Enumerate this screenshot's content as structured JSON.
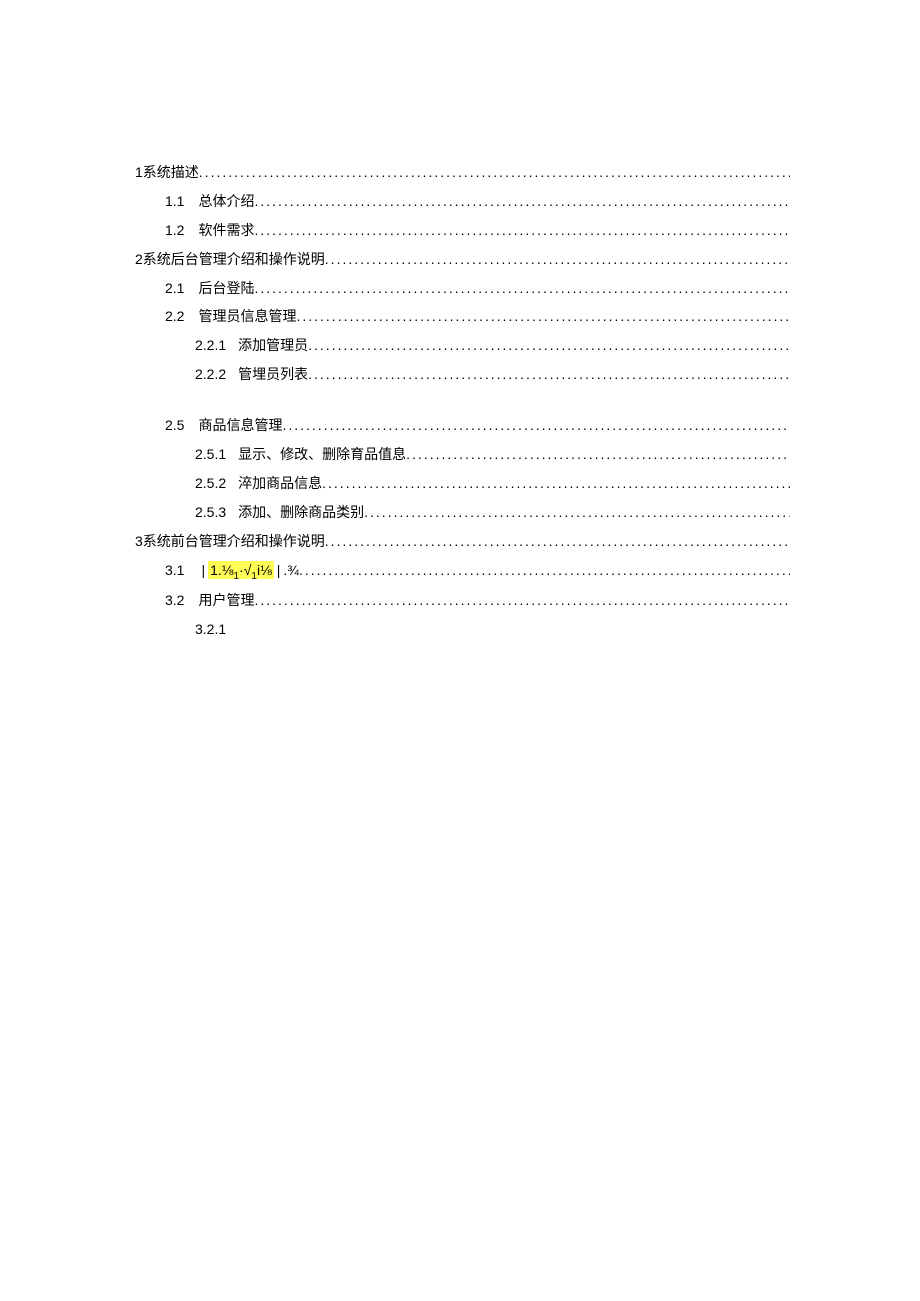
{
  "toc": {
    "leader": "............................................................................................................................................................................................",
    "items": [
      {
        "num": "1",
        "title": "系统描述",
        "level": 0
      },
      {
        "num": "1.1",
        "title": "总体介绍",
        "level": 1
      },
      {
        "num": "1.2",
        "title": "软件需求",
        "level": 1
      },
      {
        "num": "2",
        "title": "系统后台管理介绍和操作说明",
        "level": 0
      },
      {
        "num": "2.1",
        "title": "后台登陆",
        "level": 1
      },
      {
        "num": "2.2",
        "title": "管理员信息管理",
        "level": 1
      },
      {
        "num": "2.2.1",
        "title": "添加管理员",
        "level": 2
      },
      {
        "num": "2.2.2",
        "title": "管埋员列表",
        "level": 2
      },
      {
        "type": "blank"
      },
      {
        "num": "2.5",
        "title": "商品信息管理",
        "level": 1
      },
      {
        "num": "2.5.1",
        "title": "显示、修改、删除育品值息",
        "level": 2
      },
      {
        "num": "2.5.2",
        "title": "淬加商品信息",
        "level": 2
      },
      {
        "num": "2.5.3",
        "title": "添加、删除商品类别",
        "level": 2
      },
      {
        "num": "3",
        "title": "系统前台管理介绍和操作说明",
        "level": 0
      },
      {
        "num": "3.1",
        "title": "",
        "level": 1,
        "special_garbled": true,
        "garbled_parts": {
          "bar1": "|",
          "highlight_html": "1.⅛<sub class='sub1'>1</sub>·√<sub class='sub1'>1</sub>i⅛",
          "bar2": "|",
          "after": ".¾"
        }
      },
      {
        "num": "3.2",
        "title": "用户管理",
        "level": 1
      },
      {
        "num": "3.2.1",
        "title": "",
        "level": 2,
        "no_leader": true
      }
    ]
  }
}
